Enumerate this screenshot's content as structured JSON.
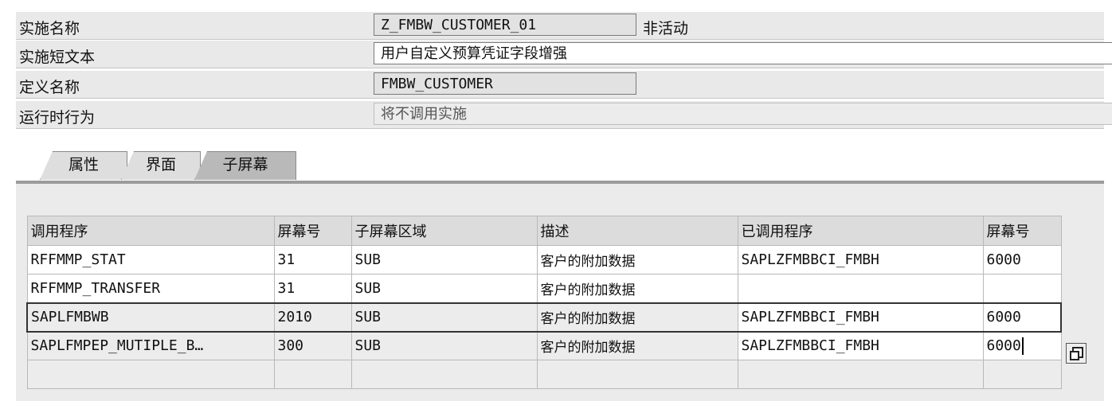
{
  "header": {
    "impl_name_label": "实施名称",
    "impl_name_value": "Z_FMBW_CUSTOMER_01",
    "impl_status": "非活动",
    "short_text_label": "实施短文本",
    "short_text_value": "用户自定义预算凭证字段增强",
    "def_name_label": "定义名称",
    "def_name_value": "FMBW_CUSTOMER",
    "runtime_label": "运行时行为",
    "runtime_value": "将不调用实施"
  },
  "tabs": [
    {
      "label": "属性"
    },
    {
      "label": "界面"
    },
    {
      "label": "子屏幕"
    }
  ],
  "table": {
    "columns": [
      "调用程序",
      "屏幕号",
      "子屏幕区域",
      "描述",
      "已调用程序",
      "屏幕号"
    ],
    "rows": [
      [
        "RFFMMP_STAT",
        "31",
        "SUB",
        "客户的附加数据",
        "SAPLZFMBBCI_FMBH",
        "6000"
      ],
      [
        "RFFMMP_TRANSFER",
        "31",
        "SUB",
        "客户的附加数据",
        "",
        ""
      ],
      [
        "SAPLFMBWB",
        "2010",
        "SUB",
        "客户的附加数据",
        "SAPLZFMBBCI_FMBH",
        "6000"
      ],
      [
        "SAPLFMPEP_MUTIPLE_B…",
        "300",
        "SUB",
        "客户的附加数据",
        "SAPLZFMBBCI_FMBH",
        "6000"
      ]
    ]
  }
}
